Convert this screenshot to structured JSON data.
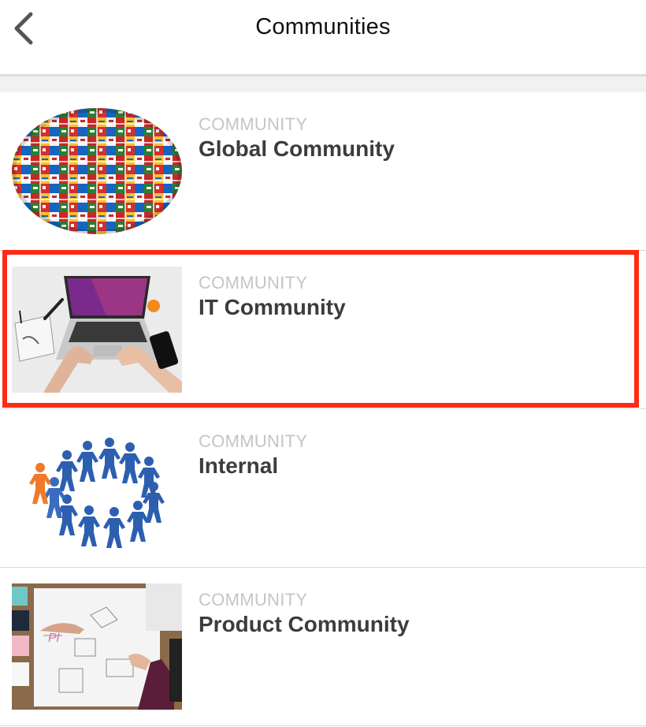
{
  "header": {
    "title": "Communities",
    "back_icon": "chevron-left-icon"
  },
  "communities": [
    {
      "kicker": "COMMUNITY",
      "name": "Global Community",
      "image": "world-flags-globe"
    },
    {
      "kicker": "COMMUNITY",
      "name": "IT Community",
      "image": "laptop-on-desk",
      "highlighted": true
    },
    {
      "kicker": "COMMUNITY",
      "name": "Internal",
      "image": "paper-people-circle"
    },
    {
      "kicker": "COMMUNITY",
      "name": "Product Community",
      "image": "design-sketches-desk"
    }
  ],
  "colors": {
    "highlight": "#ff2a14",
    "kicker": "#c5c5c5",
    "name": "#3c3c3c",
    "separator": "#d9d9d9"
  }
}
